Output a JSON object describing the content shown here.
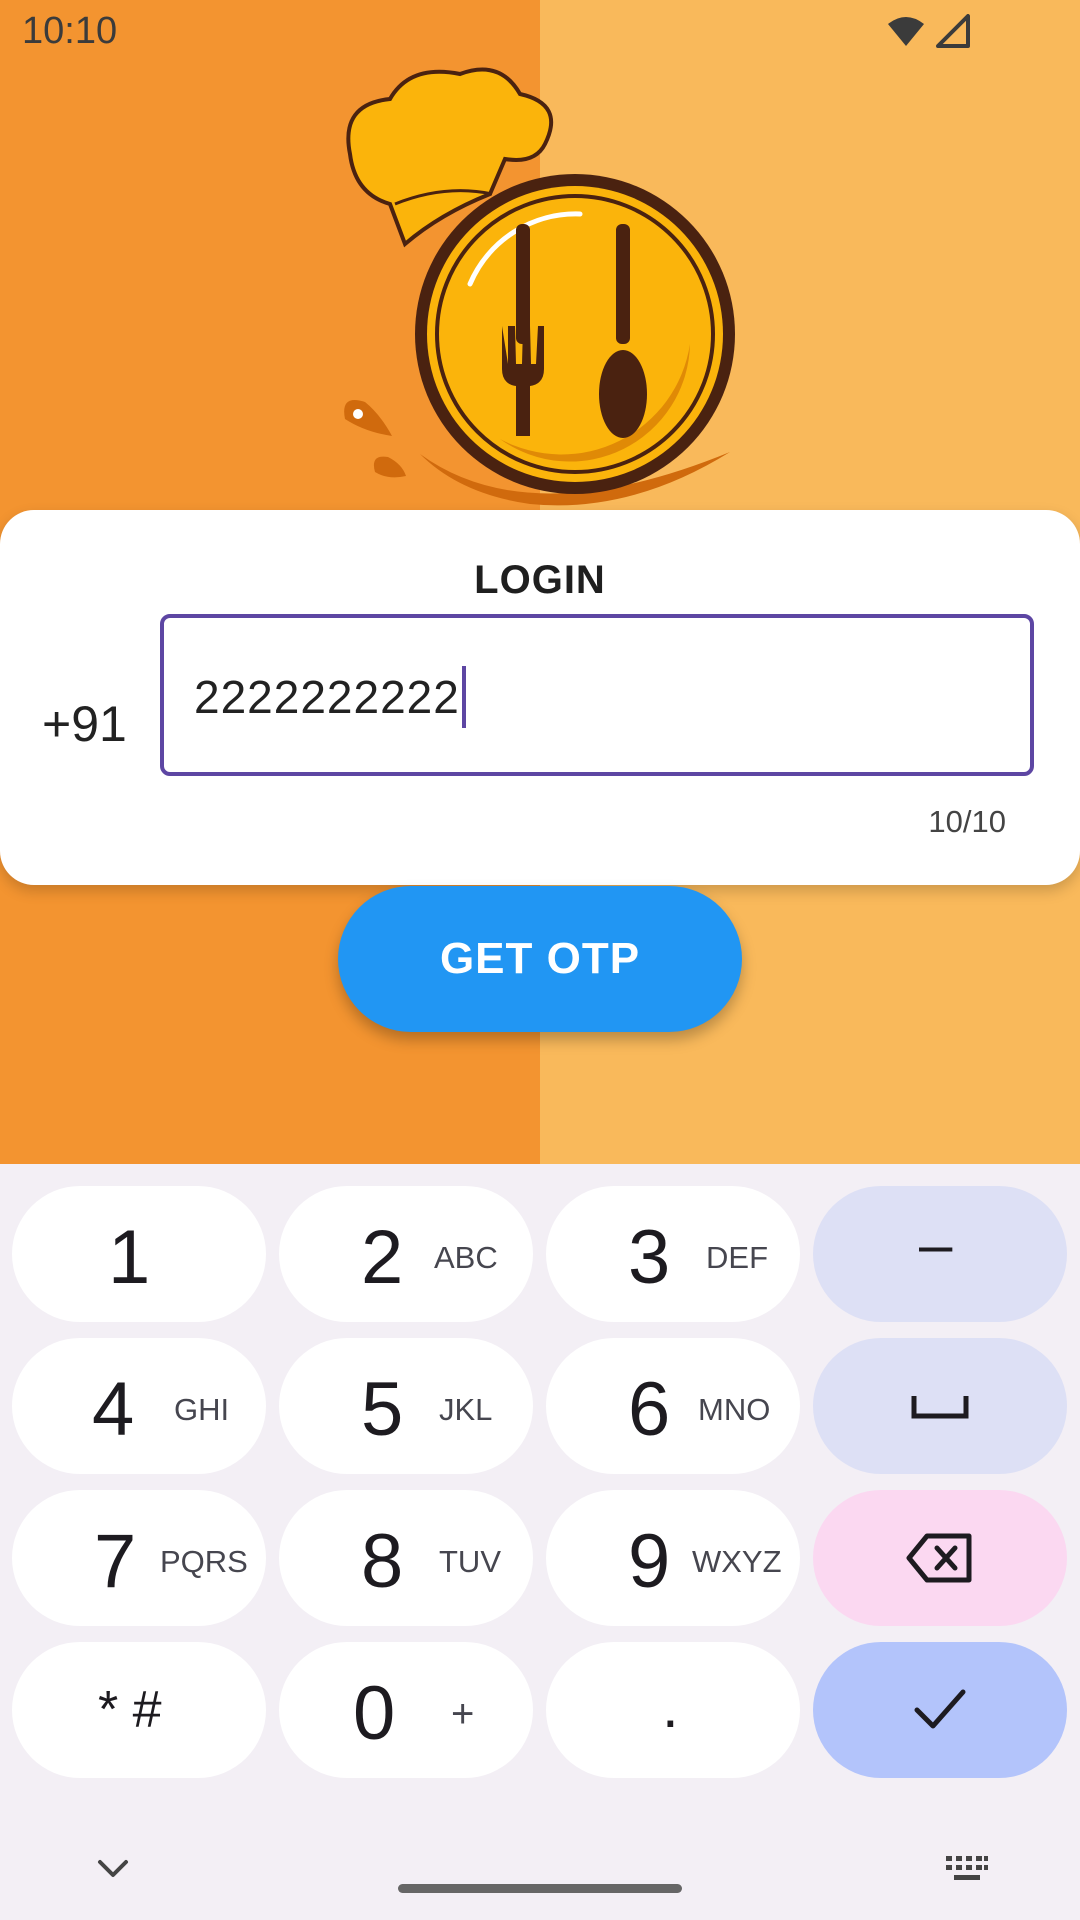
{
  "status_bar": {
    "time": "10:10"
  },
  "login": {
    "title": "LOGIN",
    "country_code": "+91",
    "phone_value": "2222222222",
    "counter": "10/10",
    "get_otp_label": "GET OTP"
  },
  "keyboard": {
    "keys": [
      {
        "num": "1",
        "sub": ""
      },
      {
        "num": "2",
        "sub": "ABC"
      },
      {
        "num": "3",
        "sub": "DEF"
      },
      {
        "num": "–",
        "sub": ""
      },
      {
        "num": "4",
        "sub": "GHI"
      },
      {
        "num": "5",
        "sub": "JKL"
      },
      {
        "num": "6",
        "sub": "MNO"
      },
      {
        "num": "7",
        "sub": "PQRS"
      },
      {
        "num": "8",
        "sub": "TUV"
      },
      {
        "num": "9",
        "sub": "WXYZ"
      },
      {
        "num": "* #",
        "sub": ""
      },
      {
        "num": "0",
        "sub": "+"
      },
      {
        "num": ".",
        "sub": ""
      }
    ]
  },
  "colors": {
    "bg_left": "#f39430",
    "bg_right": "#f9b95b",
    "accent": "#5d46a3",
    "button": "#2196f3"
  }
}
